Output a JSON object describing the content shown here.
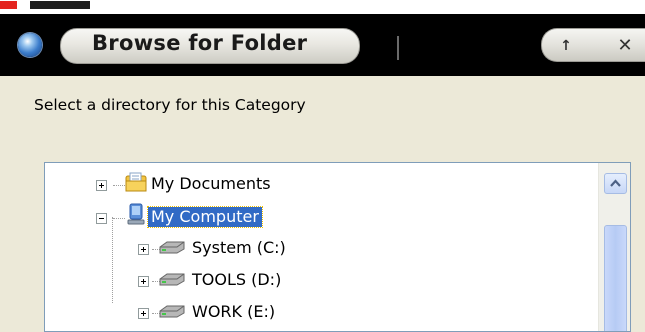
{
  "dialog": {
    "title": "Browse for Folder",
    "up_button": "↑",
    "close_button": "✕",
    "prompt": "Select a directory for this Category"
  },
  "tree": {
    "items": [
      {
        "label": "My Documents",
        "icon": "my-documents-folder-icon",
        "expander": "plus"
      },
      {
        "label": "My Computer",
        "icon": "my-computer-icon",
        "expander": "minus",
        "selected": true
      },
      {
        "label": "System (C:)",
        "icon": "hard-drive-icon",
        "expander": "plus"
      },
      {
        "label": "TOOLS (D:)",
        "icon": "hard-drive-icon",
        "expander": "plus"
      },
      {
        "label": "WORK (E:)",
        "icon": "hard-drive-icon",
        "expander": "plus"
      }
    ]
  },
  "colors": {
    "titlebar": "#000000",
    "dialog_bg": "#ece9d8",
    "selection": "#316ac5",
    "scrollbar_thumb": "#b6cbf4"
  }
}
